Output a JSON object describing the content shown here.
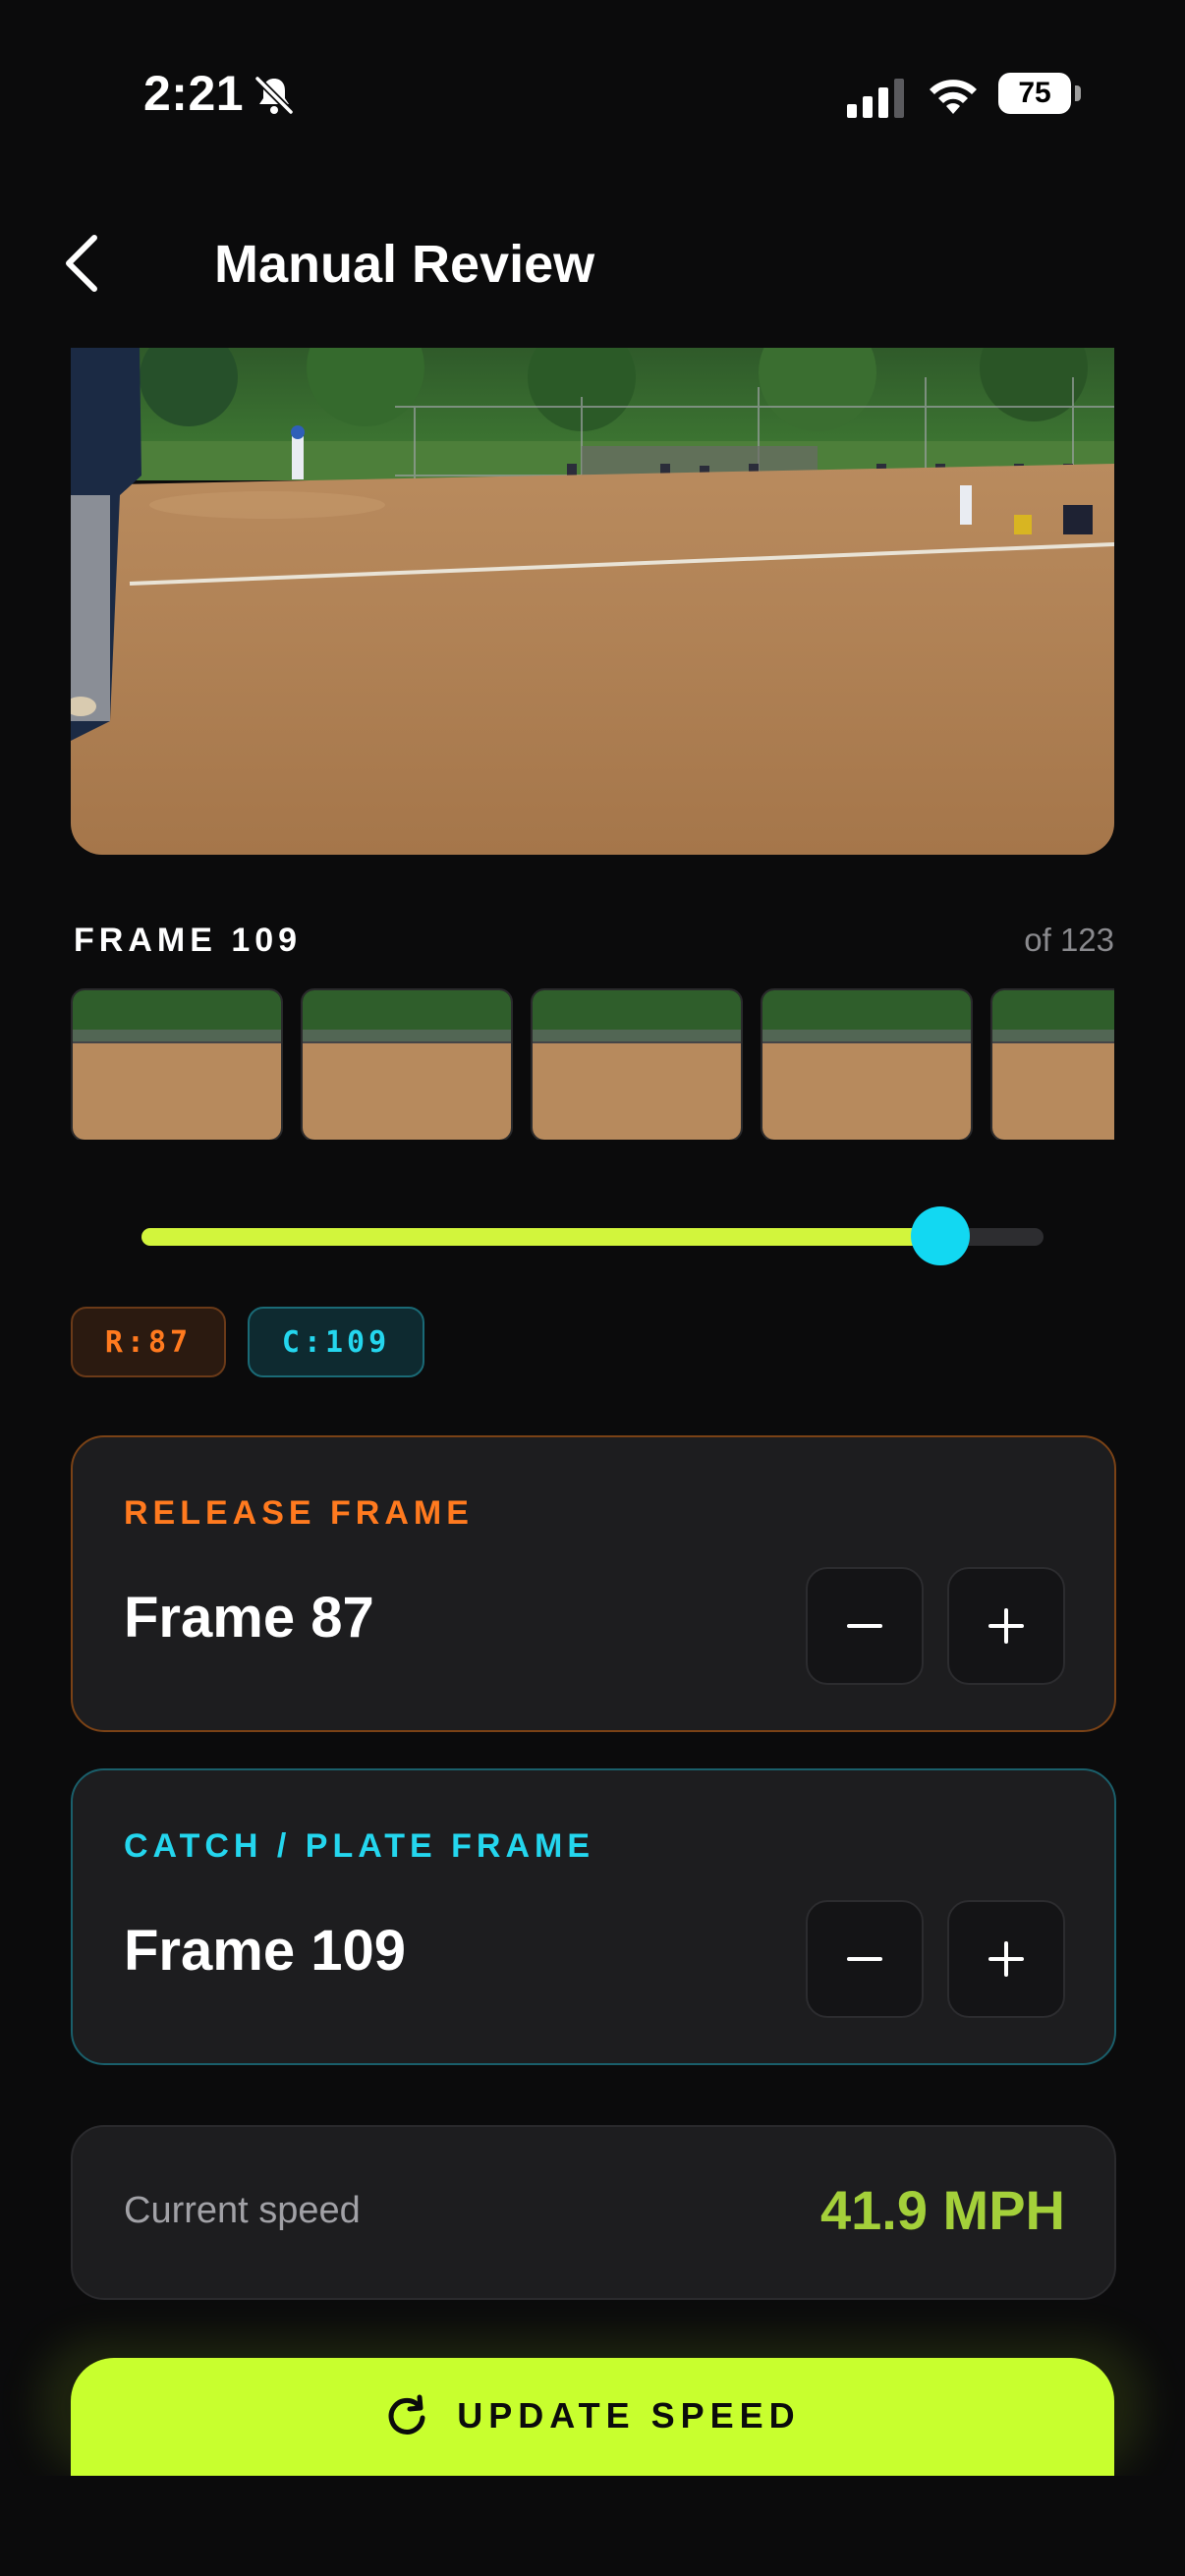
{
  "status_bar": {
    "time": "2:21",
    "battery": "75",
    "icons": [
      "bell-slash-icon",
      "cellular-signal-icon",
      "wifi-icon",
      "battery-icon"
    ]
  },
  "header": {
    "title": "Manual Review",
    "back_icon": "chevron-left-icon"
  },
  "frame": {
    "current_label": "FRAME 109",
    "total_label": "of 123",
    "slider_fraction": 0.886
  },
  "chips": {
    "release": "R:87",
    "catch": "C:109"
  },
  "release_card": {
    "label": "RELEASE FRAME",
    "value": "Frame 87"
  },
  "catch_card": {
    "label": "CATCH / PLATE FRAME",
    "value": "Frame 109"
  },
  "speed": {
    "label": "Current speed",
    "value": "41.9 MPH"
  },
  "update_button": {
    "label": "UPDATE SPEED",
    "icon": "refresh-icon"
  },
  "colors": {
    "accent_lime": "#c8ff2e",
    "release_orange": "#ff7a1f",
    "catch_cyan": "#24d6ee",
    "speed_green": "#a4d03a"
  }
}
